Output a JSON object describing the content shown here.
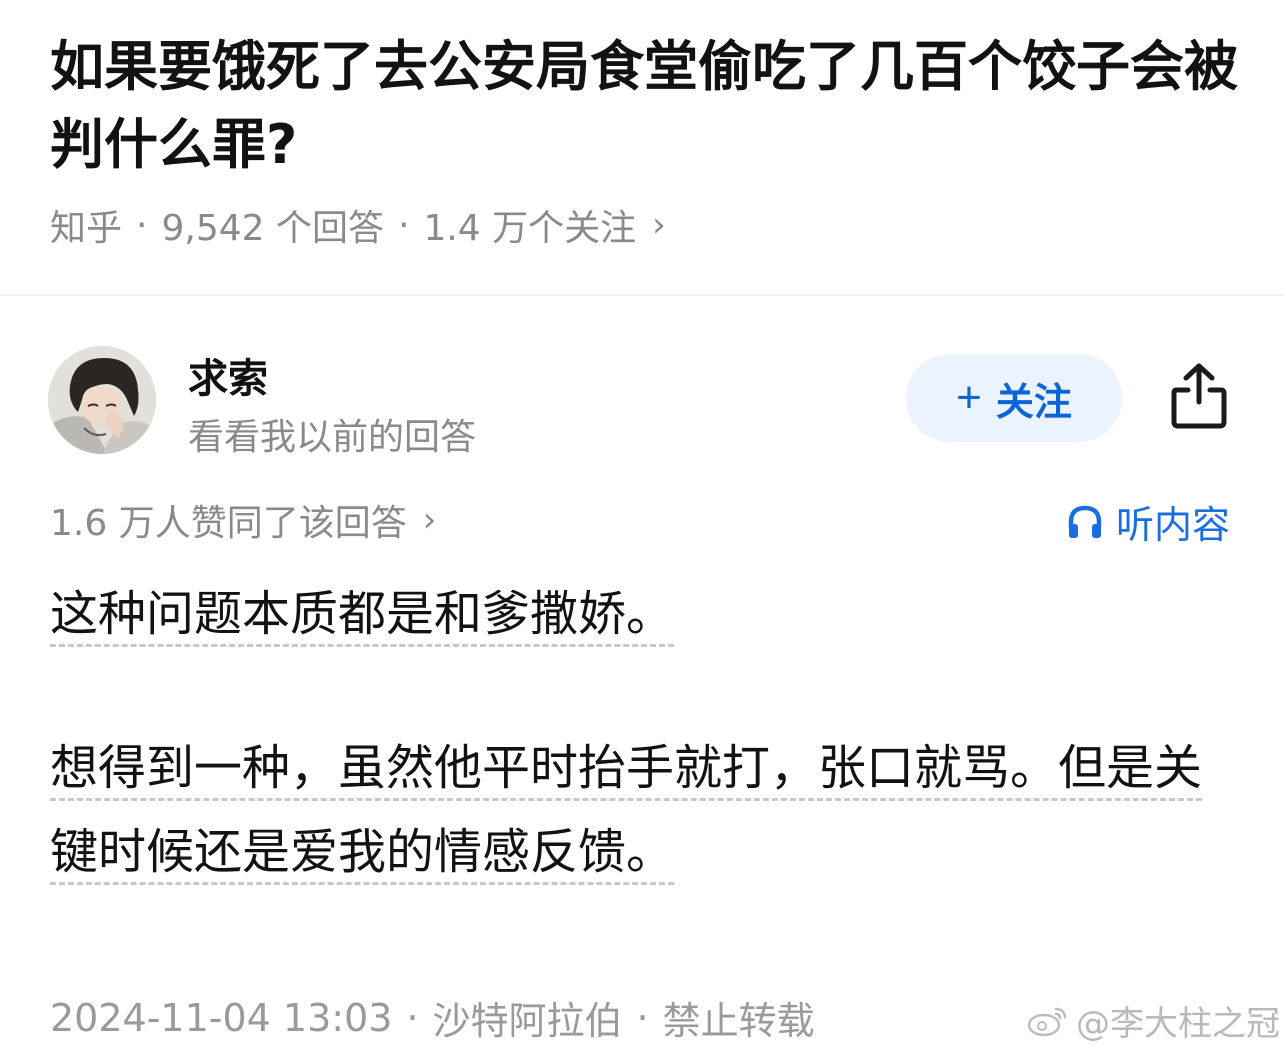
{
  "question": {
    "title": "如果要饿死了去公安局食堂偷吃了几百个饺子会被判什么罪?",
    "source": "知乎",
    "answers_count": "9,542 个回答",
    "followers": "1.4 万个关注",
    "chevron": "›"
  },
  "author": {
    "name": "求索",
    "bio": "看看我以前的回答",
    "follow_plus": "+",
    "follow_label": "关注"
  },
  "answer": {
    "vote_info": "1.6 万人赞同了该回答",
    "listen_label": "听内容",
    "paragraphs": [
      "这种问题本质都是和爹撒娇。",
      "想得到一种，虽然他平时抬手就打，张口就骂。但是关键时候还是爱我的情感反馈。"
    ],
    "timestamp": "2024-11-04 13:03",
    "location": "沙特阿拉伯",
    "copyright": "禁止转载"
  },
  "watermark": "@李大柱之冠",
  "icons": {
    "share": "share-icon",
    "headphone": "headphone-icon",
    "weibo": "weibo-logo-icon"
  },
  "colors": {
    "accent": "#0d64d6",
    "follow_bg": "#ebf3ff",
    "meta_text": "#8a8a8a"
  }
}
